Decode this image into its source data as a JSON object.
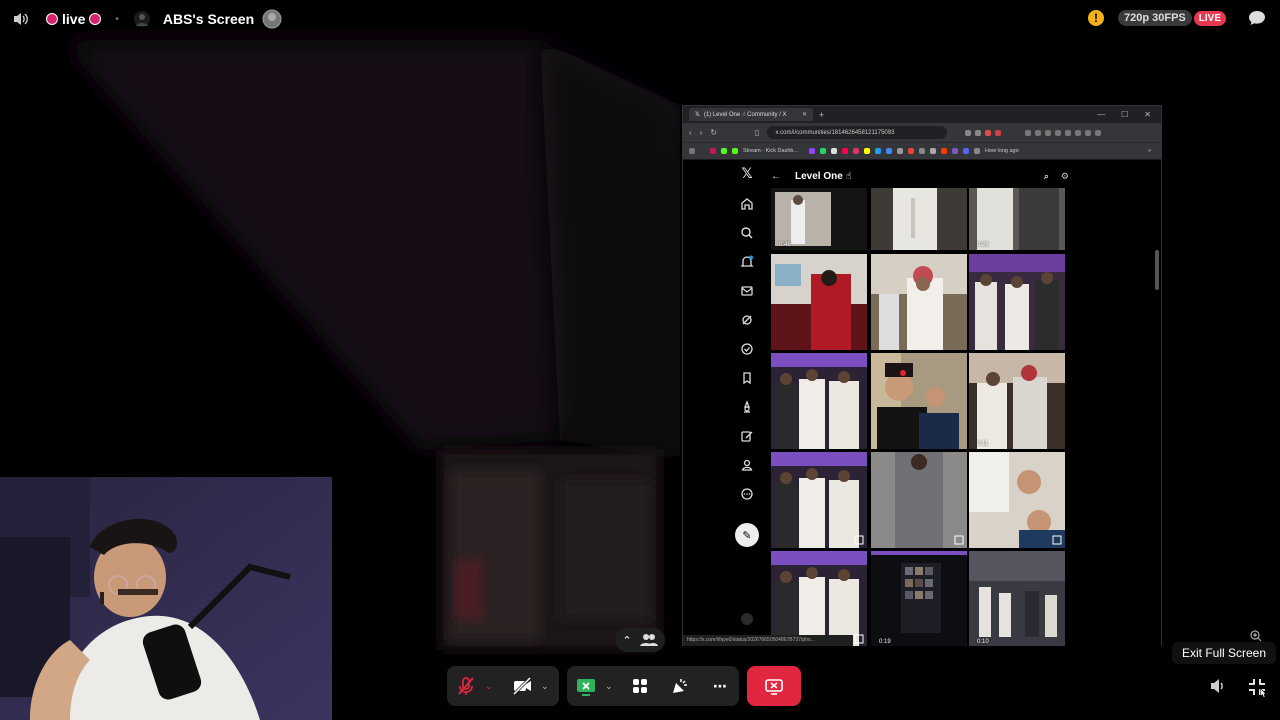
{
  "topbar": {
    "live_label": "live",
    "screen_title": "ABS's Screen",
    "quality": "720p 30FPS",
    "live_badge": "LIVE"
  },
  "browser": {
    "tab_title": "(1) Level One ☝ Community / X",
    "url": "x.com/i/communities/1814626458121175093",
    "bookmark_label": "Stream - Kick Dashb...",
    "bookmark_right": "How long ago",
    "header_title": "Level One ☝",
    "status_url": "https://x.com/i/faye0/status/202676650504867B737/pho...",
    "durations": [
      "0:46",
      "0:26",
      "0:11",
      "0:19",
      "0:10"
    ]
  },
  "icons": {
    "volume": "speaker-icon",
    "warning": "warning-icon",
    "chat": "chat-bubble-icon",
    "mic": "mic-muted-icon",
    "camera": "camera-off-icon",
    "screenshare": "screen-share-icon",
    "activities": "activities-icon",
    "soundboard": "soundboard-icon",
    "more": "more-icon",
    "end": "end-stream-icon",
    "exit_fs": "exit-fullscreen-icon"
  },
  "colors": {
    "live_pink": "#d6246e",
    "end_red": "#e0273f",
    "live_badge": "#e53950",
    "screenshare_green": "#2fb35b"
  },
  "tooltip": "Exit Full Screen"
}
